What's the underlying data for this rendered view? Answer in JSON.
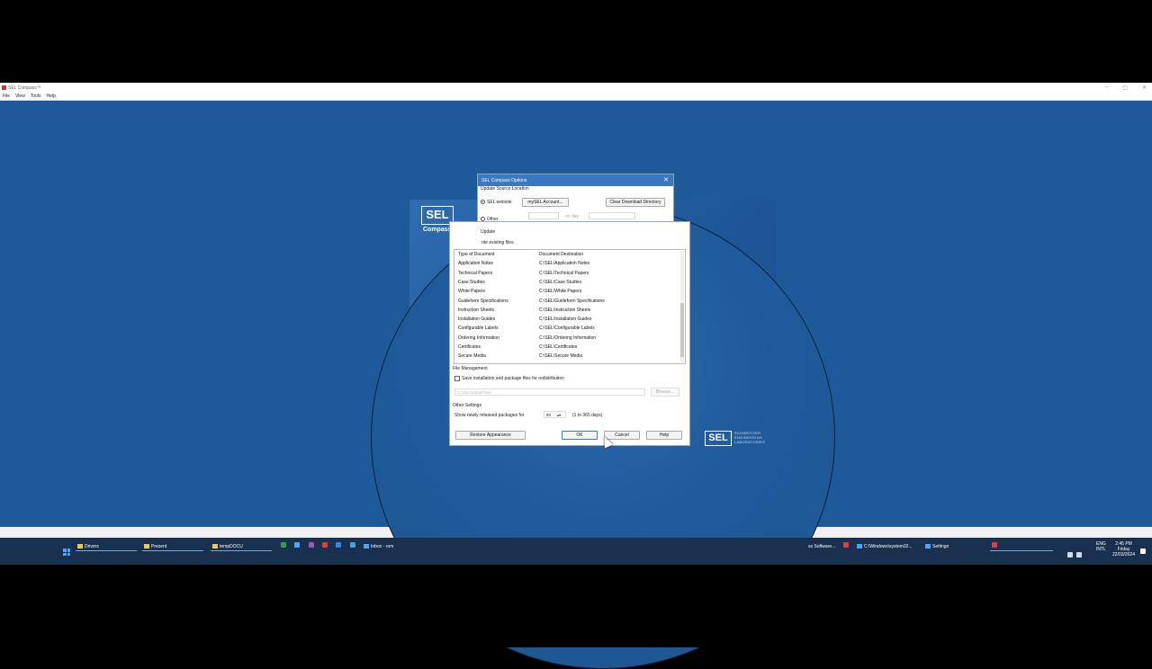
{
  "app": {
    "title": "SEL Compass™"
  },
  "window_controls": {
    "minimize": "–",
    "maximize": "▢",
    "close": "✕"
  },
  "menu": [
    "File",
    "View",
    "Tools",
    "Help"
  ],
  "splash": {
    "logo": "SEL",
    "product": "Compass™",
    "company_logo": "SEL",
    "company_name": [
      "SCHWEITZER",
      "ENGINEERING",
      "LABORATORIES"
    ]
  },
  "dialog": {
    "title": "SEL Compass Options",
    "close": "✕",
    "update_source_label": "Update Source Location",
    "sel_website_label": "SEL website",
    "mysel_account_button": "mySEL Account...",
    "clear_download_button": "Clear Download Directory",
    "other_label": "Other",
    "on_day_label": "on day",
    "update_label": "Update",
    "overwrite_label": "rite existing files",
    "table": {
      "headers": [
        "Type of Document",
        "Document Destination"
      ],
      "rows": [
        [
          "Application Notes",
          "C:\\SEL\\Application Notes"
        ],
        [
          "Technical Papers",
          "C:\\SEL\\Technical Papers"
        ],
        [
          "Case Studies",
          "C:\\SEL\\Case Studies"
        ],
        [
          "White Papers",
          "C:\\SEL\\White Papers"
        ],
        [
          "Guideform Specifications",
          "C:\\SEL\\Guideform Specifications"
        ],
        [
          "Instruction Sheets",
          "C:\\SEL\\Instruction Sheets"
        ],
        [
          "Installation Guides",
          "C:\\SEL\\Installation Guides"
        ],
        [
          "Configurable Labels",
          "C:\\SEL\\Configurable Labels"
        ],
        [
          "Ordering Information",
          "C:\\SEL\\Ordering Information"
        ],
        [
          "Certificates",
          "C:\\SEL\\Certificates"
        ],
        [
          "Secure Media",
          "C:\\SEL\\Secure Media"
        ]
      ]
    },
    "file_management_label": "File Management",
    "save_install_label": "Save installation and package files for redistribution",
    "setup_path_placeholder": "C:\\SEL\\SetupFiles\\",
    "browse_button": "Browse...",
    "other_settings_label": "Other Settings",
    "show_new_label": "Show newly released packages for",
    "days_value": "60",
    "days_range": "(1 to 365 days)",
    "restore_button": "Restore Appearance",
    "ok_button": "OK",
    "cancel_button": "Cancel",
    "help_button": "Help"
  },
  "taskbar": {
    "items": [
      "Drivers",
      "Present",
      "tempDOCU",
      "Inbox - rom",
      "ss Software...",
      "C:\\Windows\\system32...",
      "Settings"
    ],
    "tray": {
      "lang1": "ENG",
      "lang2": "INTL",
      "time": "2:45 PM",
      "day": "Friday",
      "date": "22/03/2024"
    }
  },
  "colors": {
    "desktop": "#1e5a9a",
    "titlebar": "#3a78c0",
    "taskbar": "#19314f"
  }
}
